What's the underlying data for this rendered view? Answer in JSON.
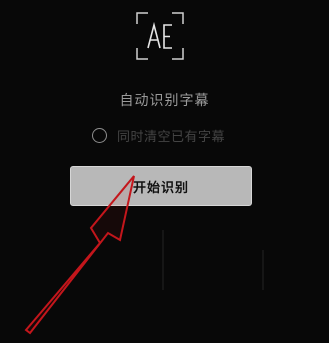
{
  "icon": {
    "name": "ae-subtitle-icon",
    "letters": "AE"
  },
  "title": "自动识别字幕",
  "clear_option": {
    "label": "同时清空已有字幕",
    "checked": false
  },
  "start_button": {
    "label": "开始识别"
  },
  "annotation": {
    "name": "red-arrow-annotation",
    "color": "#c4161c"
  },
  "colors": {
    "background": "#080808",
    "button": "#b8b8b8",
    "title_text": "#9a9a9a"
  }
}
